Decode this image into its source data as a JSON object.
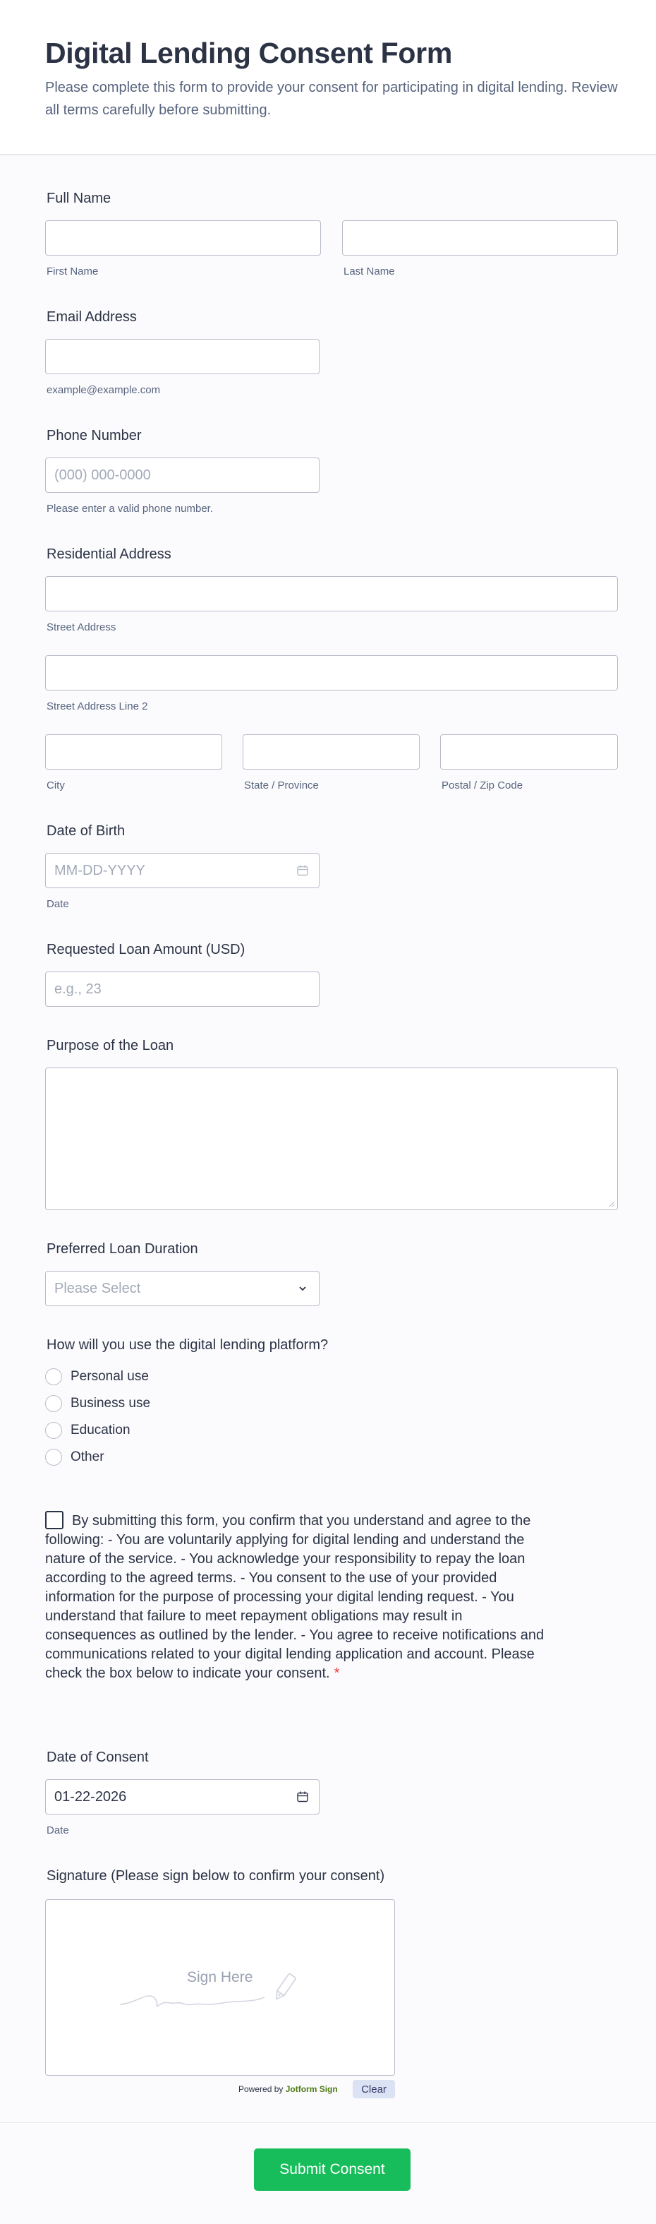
{
  "header": {
    "title": "Digital Lending Consent Form",
    "subtitle": "Please complete this form to provide your consent for participating in digital lending. Review all terms carefully before submitting."
  },
  "full_name": {
    "label": "Full Name",
    "first_sublabel": "First Name",
    "last_sublabel": "Last Name"
  },
  "email": {
    "label": "Email Address",
    "sublabel": "example@example.com"
  },
  "phone": {
    "label": "Phone Number",
    "placeholder": "(000) 000-0000",
    "sublabel": "Please enter a valid phone number."
  },
  "address": {
    "label": "Residential Address",
    "street_sublabel": "Street Address",
    "street2_sublabel": "Street Address Line 2",
    "city_sublabel": "City",
    "state_sublabel": "State / Province",
    "zip_sublabel": "Postal / Zip Code"
  },
  "dob": {
    "label": "Date of Birth",
    "placeholder": "MM-DD-YYYY",
    "sublabel": "Date"
  },
  "loan_amount": {
    "label": "Requested Loan Amount (USD)",
    "placeholder": "e.g., 23"
  },
  "purpose": {
    "label": "Purpose of the Loan"
  },
  "duration": {
    "label": "Preferred Loan Duration",
    "placeholder": "Please Select"
  },
  "usage": {
    "label": "How will you use the digital lending platform?",
    "options": [
      "Personal use",
      "Business use",
      "Education",
      "Other"
    ]
  },
  "consent": {
    "text": "By submitting this form, you confirm that you understand and agree to the following: - You are voluntarily applying for digital lending and understand the nature of the service. - You acknowledge your responsibility to repay the loan according to the agreed terms. - You consent to the use of your provided information for the purpose of processing your digital lending request. - You understand that failure to meet repayment obligations may result in consequences as outlined by the lender. - You agree to receive notifications and communications related to your digital lending application and account. Please check the box below to indicate your consent.",
    "required_mark": "*"
  },
  "consent_date": {
    "label": "Date of Consent",
    "value": "01-22-2026",
    "sublabel": "Date"
  },
  "signature": {
    "label": "Signature (Please sign below to confirm your consent)",
    "placeholder": "Sign Here",
    "powered_by": "Powered by",
    "brand": "Jotform Sign",
    "clear_label": "Clear"
  },
  "submit": {
    "label": "Submit Consent"
  },
  "colors": {
    "submit": "#18bd5b",
    "required": "#f23a3c",
    "brand": "#4c7a12"
  }
}
